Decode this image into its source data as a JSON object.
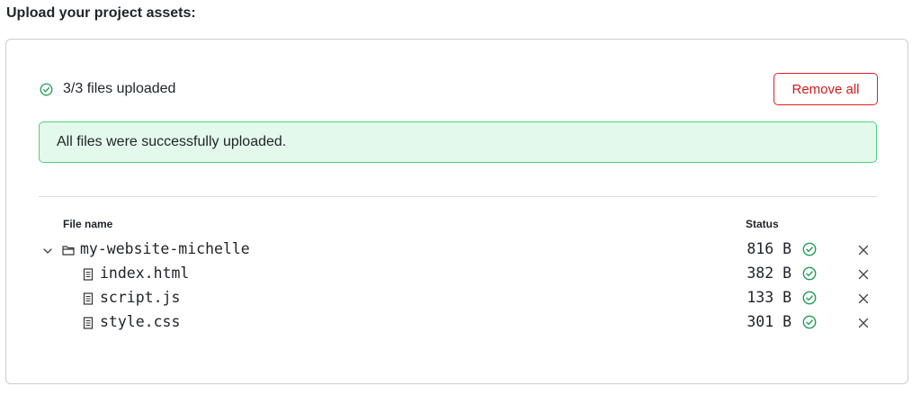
{
  "page": {
    "title": "Upload your project assets:"
  },
  "uploader": {
    "summary": "3/3 files uploaded",
    "remove_all_label": "Remove all",
    "alert_message": "All files were successfully uploaded.",
    "columns": {
      "name": "File name",
      "status": "Status"
    },
    "folder": {
      "name": "my-website-michelle",
      "size": "816 B",
      "expanded": true,
      "status": "uploaded"
    },
    "files": [
      {
        "name": "index.html",
        "size": "382 B",
        "status": "uploaded"
      },
      {
        "name": "script.js",
        "size": "133 B",
        "status": "uploaded"
      },
      {
        "name": "style.css",
        "size": "301 B",
        "status": "uploaded"
      }
    ]
  },
  "icons": {
    "summary": "check-circle-icon",
    "folder_toggle": "chevron-down-icon",
    "folder": "folder-icon",
    "file": "file-icon",
    "row_status": "check-circle-icon",
    "row_remove": "close-icon"
  },
  "colors": {
    "success": "#1f9d55",
    "danger": "#d11a1a",
    "alert_bg": "#e3f9ec",
    "alert_border": "#4bd37b"
  }
}
